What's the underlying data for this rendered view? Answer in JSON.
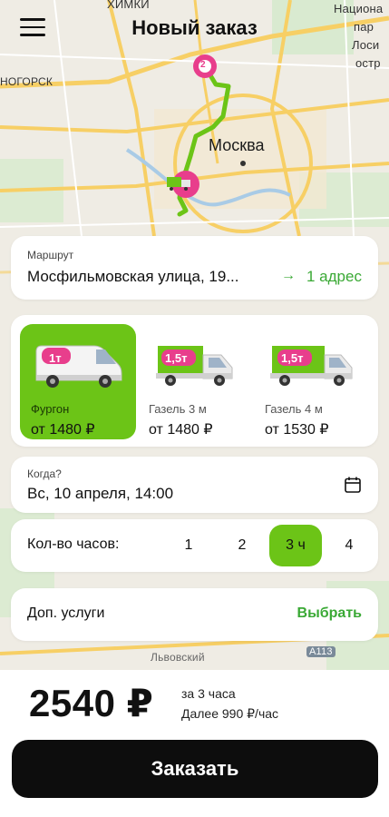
{
  "header": {
    "title": "Новый заказ"
  },
  "map": {
    "labels": {
      "khimki": "ХИМКИ",
      "national": "Национа",
      "national2": "пар",
      "national3": "Лоси",
      "national4": "остр",
      "krasnogorsk": "НОГОРСК",
      "moscow": "Москва",
      "lvovsky": "Львовский",
      "road": "A113"
    },
    "pins": {
      "destination_number": "2"
    },
    "colors": {
      "route": "#6cc417",
      "pin": "#e83e8c"
    }
  },
  "route": {
    "label": "Маршрут",
    "from": "Мосфильмовская улица, 19...",
    "arrow": "→",
    "to": "1 адрес"
  },
  "vehicles": [
    {
      "badge": "1т",
      "name": "Фургон",
      "price": "от 1480 ₽",
      "active": true
    },
    {
      "badge": "1,5т",
      "name": "Газель 3 м",
      "price": "от 1480 ₽",
      "active": false
    },
    {
      "badge": "1,5т",
      "name": "Газель 4 м",
      "price": "от 1530 ₽",
      "active": false
    }
  ],
  "when": {
    "label": "Когда?",
    "value": "Вс, 10 апреля, 14:00",
    "icon": "calendar-icon"
  },
  "hours": {
    "label": "Кол-во часов:",
    "options": [
      "1",
      "2",
      "3 ч",
      "4"
    ],
    "selected_index": 2
  },
  "services": {
    "label": "Доп. услуги",
    "action": "Выбрать"
  },
  "summary": {
    "price": "2540 ₽",
    "note1": "за 3 часа",
    "note2": "Далее 990 ₽/час"
  },
  "order_button": {
    "label": "Заказать"
  },
  "colors": {
    "accent": "#6cc417",
    "accent_text": "#3aa935",
    "badge": "#e83e8c",
    "button_bg": "#0d0d0d"
  }
}
